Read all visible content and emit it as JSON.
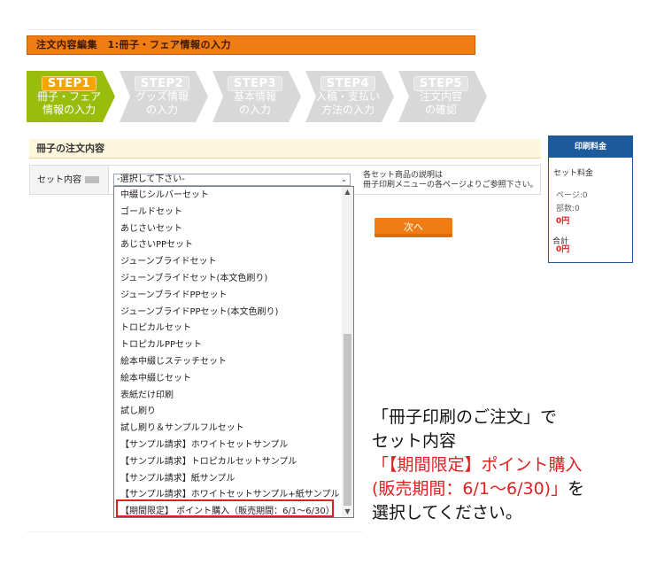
{
  "header": {
    "title": "注文内容編集　1:冊子・フェア情報の入力"
  },
  "steps": [
    {
      "badge": "STEP1",
      "label": "冊子・フェア\n情報の入力",
      "state": "active",
      "color": "#9abd0b"
    },
    {
      "badge": "STEP2",
      "label": "グッズ情報\nの入力",
      "state": "inactive",
      "color": "#d8d8d8"
    },
    {
      "badge": "STEP3",
      "label": "基本情報\nの入力",
      "state": "inactive",
      "color": "#d8d8d8"
    },
    {
      "badge": "STEP4",
      "label": "入稿・支払い\n方法の入力",
      "state": "inactive",
      "color": "#d8d8d8"
    },
    {
      "badge": "STEP5",
      "label": "注文内容\nの確認",
      "state": "inactive",
      "color": "#d8d8d8"
    }
  ],
  "section": {
    "title": "冊子の注文内容"
  },
  "form": {
    "set_label": "セット内容",
    "select_value": "-選択して下さい-",
    "help_line1": "各セット商品の説明は",
    "help_line2": "冊子印刷メニューの各ページよりご参照下さい。"
  },
  "dropdown": {
    "options": [
      "中綴じシルバーセット",
      "ゴールドセット",
      "あじさいセット",
      "あじさいPPセット",
      "ジューンブライドセット",
      "ジューンブライドセット(本文色刷り)",
      "ジューンブライドPPセット",
      "ジューンブライドPPセット(本文色刷り)",
      "トロピカルセット",
      "トロピカルPPセット",
      "絵本中綴じステッチセット",
      "絵本中綴じセット",
      "表紙だけ印刷",
      "試し刷り",
      "試し刷り＆サンプルフルセット",
      "【サンプル請求】ホワイトセットサンプル",
      "【サンプル請求】トロピカルセットサンプル",
      "【サンプル請求】紙サンプル",
      "【サンプル請求】ホワイトセットサンプル+紙サンプル",
      "【期間限定】 ポイント購入（販売期間：6/1〜6/30）"
    ]
  },
  "buttons": {
    "next": "次へ"
  },
  "sidebar": {
    "title": "印刷料金",
    "set_price_label": "セット料金",
    "pages": "ページ:0",
    "copies": "部数:0",
    "price": "0円",
    "total_label": "合計",
    "total": "0円"
  },
  "note": {
    "line1": "「冊子印刷のご注文」で",
    "line2": "セット内容",
    "line3": "「【期間限定】ポイント購入",
    "line4": "(販売期間：6/1〜6/30)」",
    "line4_suffix": "を",
    "line5": "選択してください。"
  },
  "colors": {
    "accent": "#f07d14",
    "step_active": "#9abd0b",
    "highlight": "#e02020",
    "side_head": "#1d5a9c"
  }
}
